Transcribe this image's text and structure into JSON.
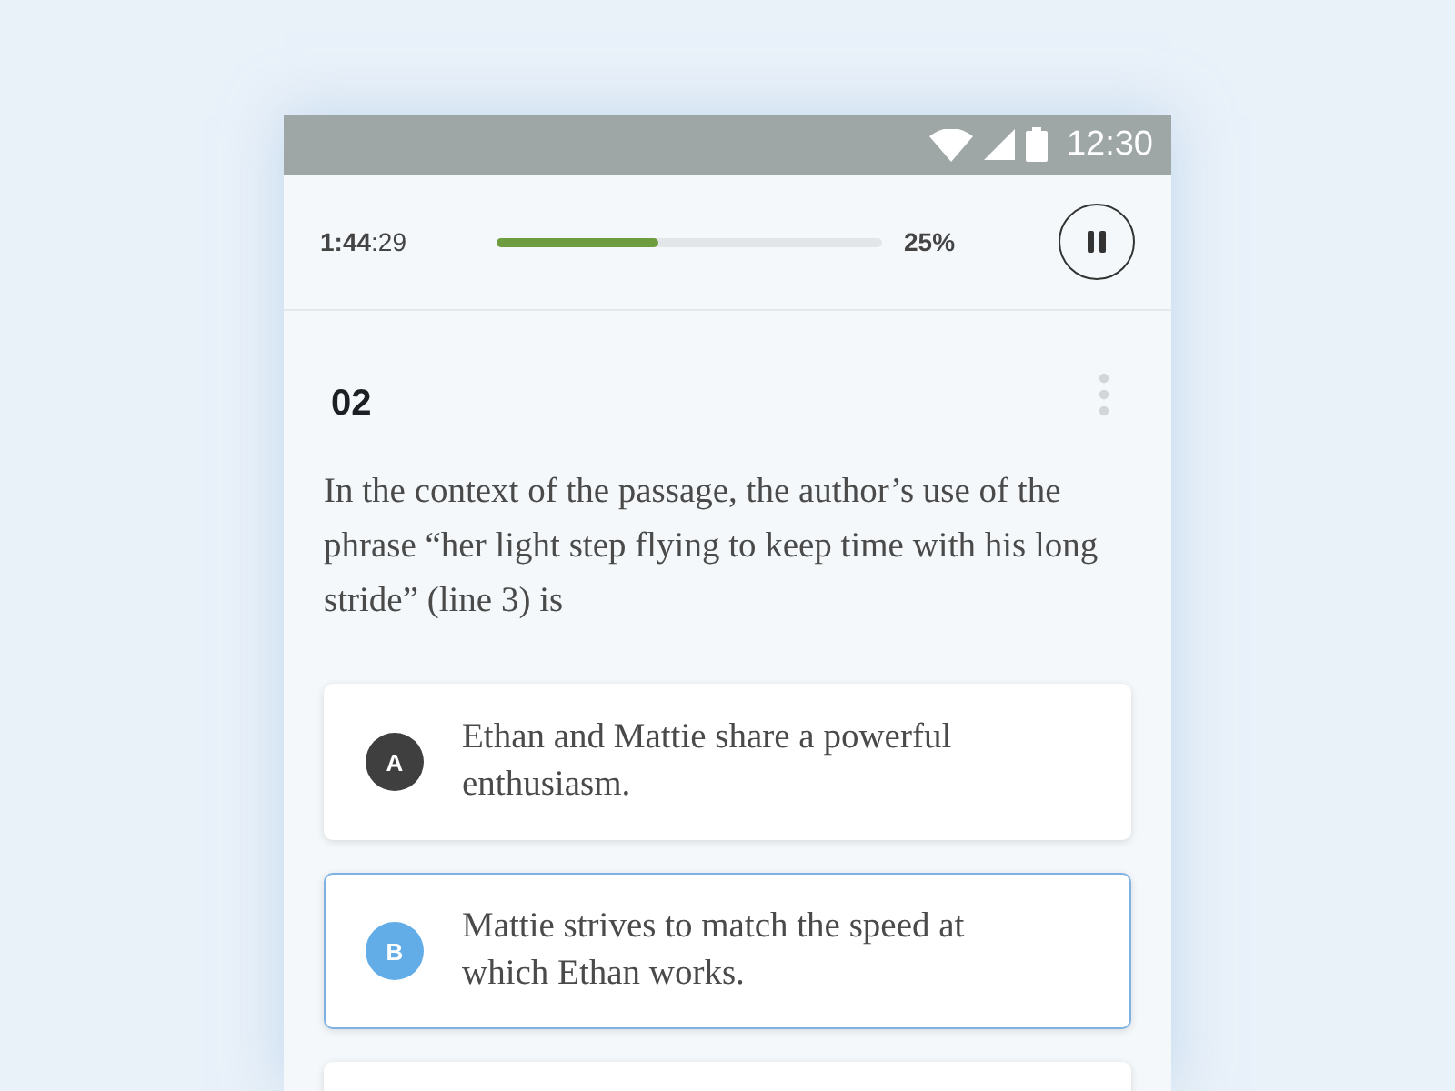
{
  "status_bar": {
    "time": "12:30"
  },
  "header": {
    "timer": "**1:44**:29",
    "progress": {
      "level": 0.42
    },
    "percent": "25%"
  },
  "question": {
    "number": "02",
    "text": "In the context of the passage, the author’s use of the phrase “her light step flying to keep time with his long stride” (line 3) is"
  },
  "options": [
    {
      "letter": "A",
      "text": "Ethan and Mattie share a powerful enthusiasm.",
      "selected": false
    },
    {
      "letter": "B",
      "text": "Mattie strives to match the speed at which Ethan works.",
      "selected": true
    }
  ]
}
